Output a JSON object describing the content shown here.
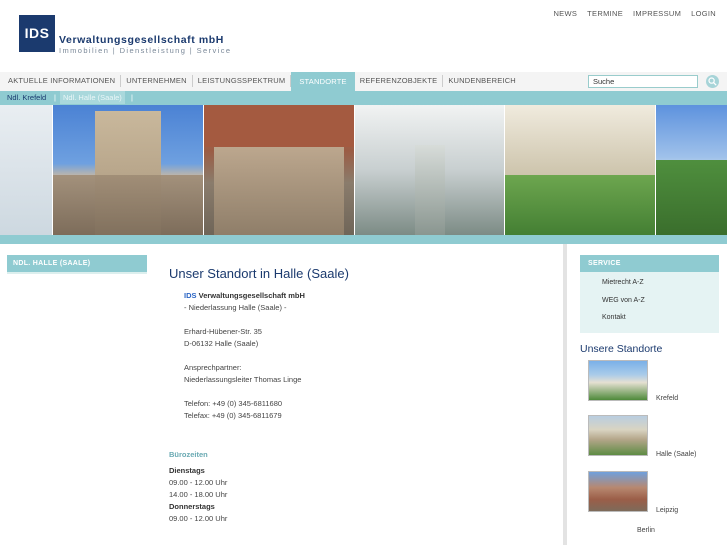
{
  "header": {
    "logo_short": "IDS",
    "logo_name": "Verwaltungsgesellschaft  mbH",
    "logo_tagline": "Immobilien | Dienstleistung | Service",
    "top_links": [
      "NEWS",
      "TERMINE",
      "IMPRESSUM",
      "LOGIN"
    ]
  },
  "mainnav": {
    "items": [
      "AKTUELLE INFORMATIONEN",
      "UNTERNEHMEN",
      "LEISTUNGSSPEKTRUM",
      "STANDORTE",
      "REFERENZOBJEKTE",
      "KUNDENBEREICH"
    ],
    "active": "STANDORTE"
  },
  "search": {
    "value": "Suche"
  },
  "subnav": {
    "items": [
      "Ndl. Krefeld",
      "Ndl. Halle (Saale)"
    ],
    "separator": "|"
  },
  "left": {
    "tab_label": "NDL. HALLE (SAALE)"
  },
  "main": {
    "title": "Unser Standort in Halle (Saale)",
    "company_prefix": "IDS",
    "company_name": "Verwaltungsgesellschaft mbH",
    "branch": "- Niederlassung Halle (Saale) -",
    "street": "Erhard-Hübener-Str. 35",
    "city": "D-06132 Halle (Saale)",
    "contact_label": "Ansprechpartner:",
    "contact_name": "Niederlassungsleiter Thomas Linge",
    "phone": "Telefon: +49 (0) 345-6811680",
    "fax": "Telefax: +49 (0) 345-6811679"
  },
  "hours": {
    "heading": "Bürozeiten",
    "day1": "Dienstags",
    "day1_t1": "09.00 - 12.00 Uhr",
    "day1_t2": "14.00 - 18.00 Uhr",
    "day2": "Donnerstags",
    "day2_t1": "09.00 - 12.00 Uhr"
  },
  "right": {
    "service_heading": "SERVICE",
    "service_items": [
      "Mietrecht A-Z",
      "WEG von A-Z",
      "Kontakt"
    ],
    "standorte_heading": "Unsere Standorte",
    "locations": [
      "Krefeld",
      "Halle (Saale)",
      "Leipzig",
      "Berlin"
    ]
  },
  "colors": {
    "accent": "#8fcbd1",
    "brand": "#1b3a6e"
  }
}
